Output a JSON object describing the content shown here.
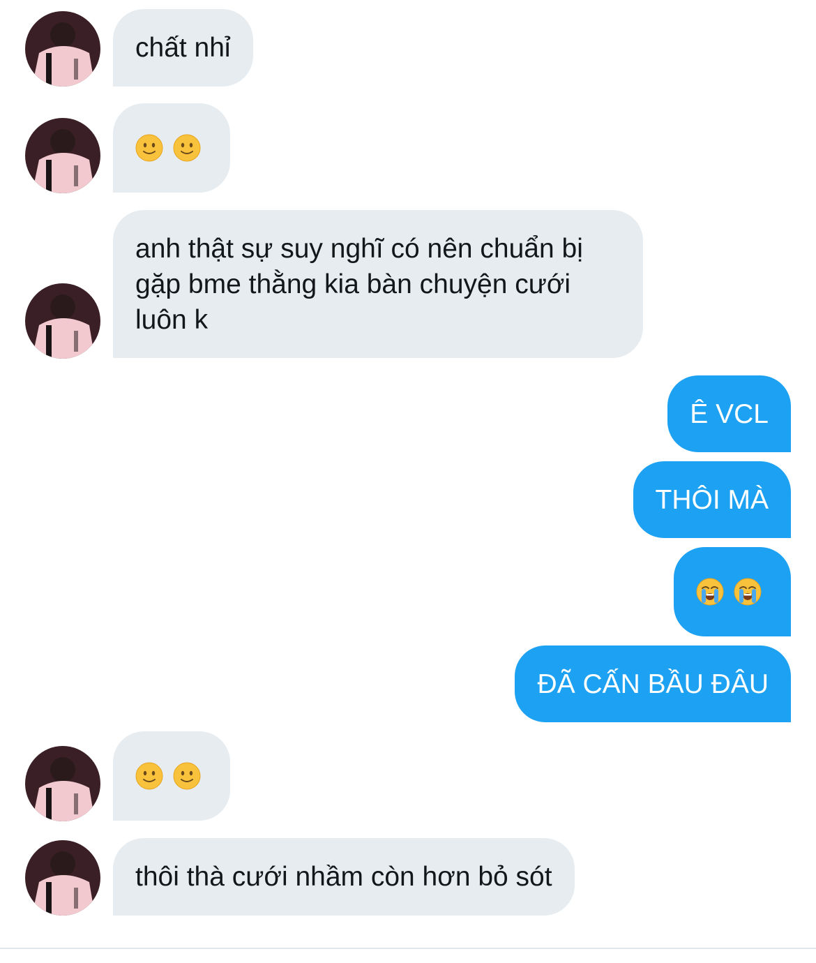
{
  "messages": [
    {
      "from": "them",
      "text": "chất nhỉ"
    },
    {
      "from": "them",
      "emoji": [
        "slightly-smiling-face",
        "slightly-smiling-face"
      ]
    },
    {
      "from": "them",
      "text": "anh thật sự suy nghĩ có nên chuẩn bị gặp bme thằng kia bàn chuyện cưới luôn k"
    },
    {
      "from": "me",
      "text": "Ê VCL"
    },
    {
      "from": "me",
      "text": "THÔI MÀ"
    },
    {
      "from": "me",
      "emoji": [
        "loudly-crying-face",
        "loudly-crying-face"
      ]
    },
    {
      "from": "me",
      "text": "ĐÃ CẤN BẦU ĐÂU"
    },
    {
      "from": "them",
      "emoji": [
        "slightly-smiling-face",
        "slightly-smiling-face"
      ]
    },
    {
      "from": "them",
      "text": "thôi thà cưới nhầm còn hơn bỏ sót"
    }
  ],
  "colors": {
    "incoming_bubble": "#e6ecf0",
    "incoming_text": "#14171a",
    "outgoing_bubble": "#1da1f2",
    "outgoing_text": "#ffffff",
    "divider": "#e1e8ed"
  }
}
